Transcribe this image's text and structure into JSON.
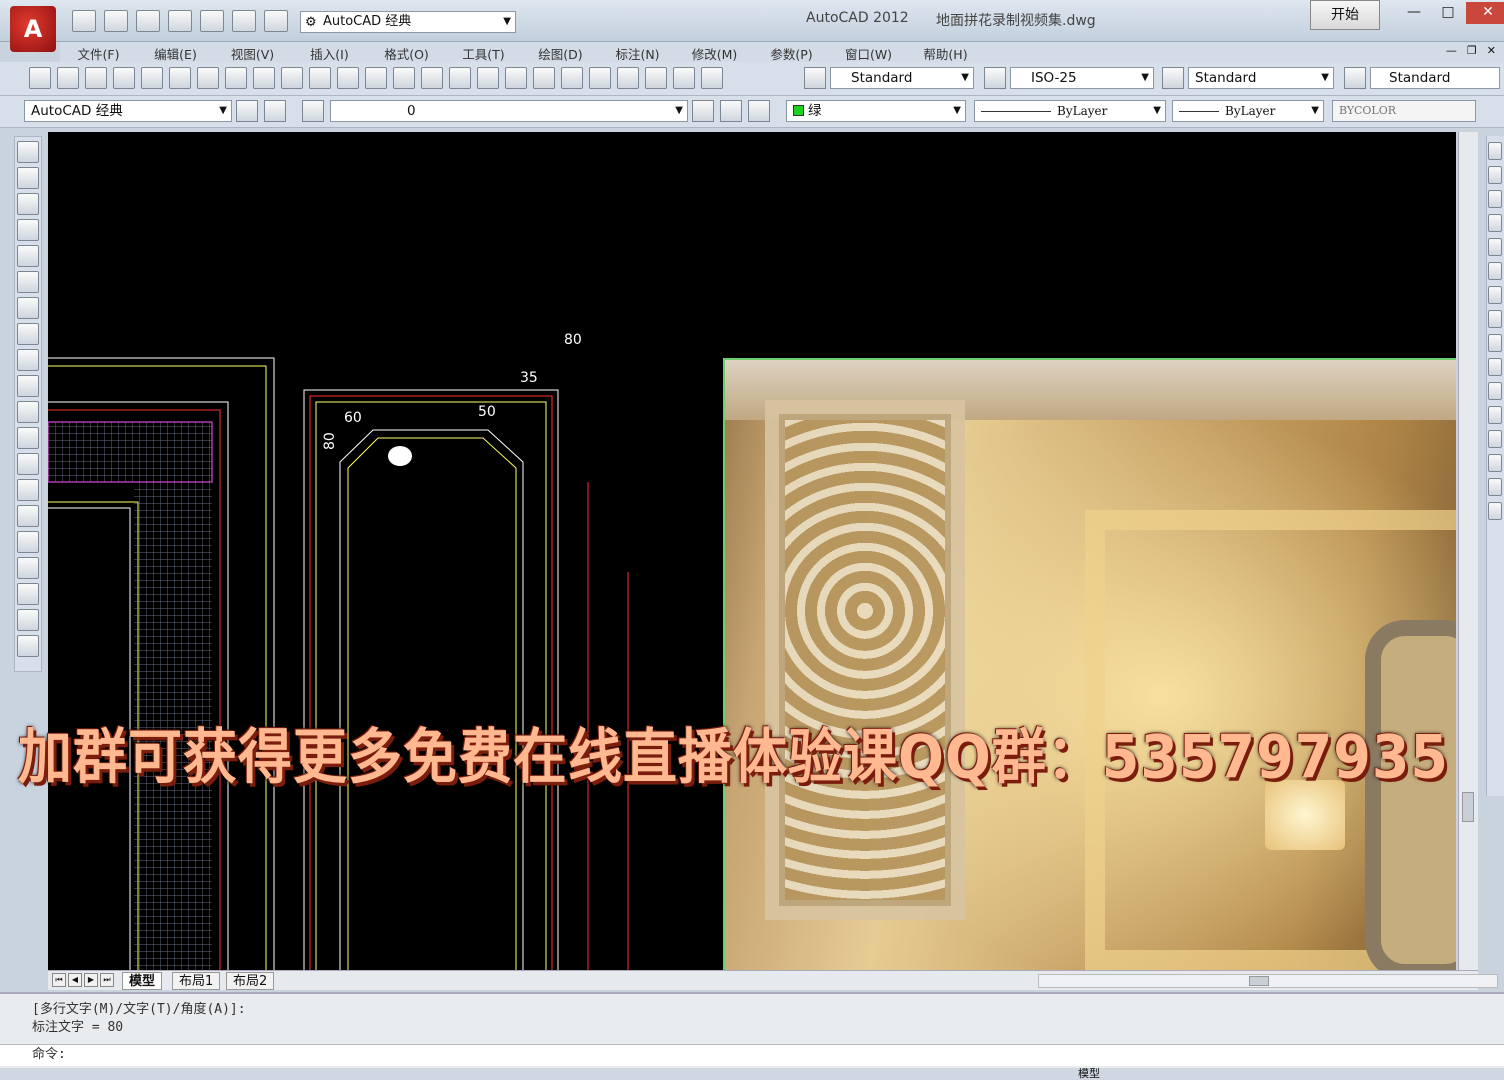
{
  "titlebar": {
    "workspace": "AutoCAD 经典",
    "app_name": "AutoCAD 2012",
    "file_name": "地面拼花录制视频集.dwg",
    "start_button": "开始"
  },
  "menu": [
    "文件(F)",
    "编辑(E)",
    "视图(V)",
    "插入(I)",
    "格式(O)",
    "工具(T)",
    "绘图(D)",
    "标注(N)",
    "修改(M)",
    "参数(P)",
    "窗口(W)",
    "帮助(H)"
  ],
  "toolbar1": {
    "text_style": "Standard",
    "dim_style": "ISO-25",
    "table_style": "Standard",
    "multileader_style": "Standard"
  },
  "toolbar2": {
    "workspace_select": "AutoCAD 经典",
    "layer": "0",
    "color": "绿",
    "linetype": "ByLayer",
    "lineweight": "ByLayer",
    "plotstyle": "BYCOLOR"
  },
  "drawing": {
    "dim_80_top": "80",
    "dim_35": "35",
    "dim_60": "60",
    "dim_50": "50",
    "dim_80_left": "80"
  },
  "banner": "加群可获得更多免费在线直播体验课QQ群：535797935",
  "tabs": [
    "模型",
    "布局1",
    "布局2"
  ],
  "command": {
    "line1": "[多行文字(M)/文字(T)/角度(A)]:",
    "line2": "标注文字 = 80",
    "prompt": "命令:"
  },
  "status": {
    "model_label": "模型"
  }
}
